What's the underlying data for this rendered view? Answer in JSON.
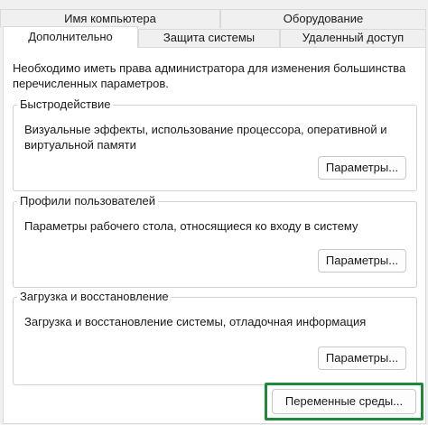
{
  "tabs_row1": [
    {
      "label": "Имя компьютера"
    },
    {
      "label": "Оборудование"
    }
  ],
  "tabs_row2": [
    {
      "label": "Дополнительно",
      "active": true
    },
    {
      "label": "Защита системы"
    },
    {
      "label": "Удаленный доступ"
    }
  ],
  "intro_text": "Необходимо иметь права администратора для изменения большинства перечисленных параметров.",
  "groups": {
    "performance": {
      "title": "Быстродействие",
      "description": "Визуальные эффекты, использование процессора, оперативной и виртуальной памяти",
      "button": "Параметры..."
    },
    "profiles": {
      "title": "Профили пользователей",
      "description": "Параметры рабочего стола, относящиеся ко входу в систему",
      "button": "Параметры..."
    },
    "startup": {
      "title": "Загрузка и восстановление",
      "description": "Загрузка и восстановление системы, отладочная информация",
      "button": "Параметры..."
    }
  },
  "env_button": "Переменные среды...",
  "highlight_color": "#1c8a3a"
}
